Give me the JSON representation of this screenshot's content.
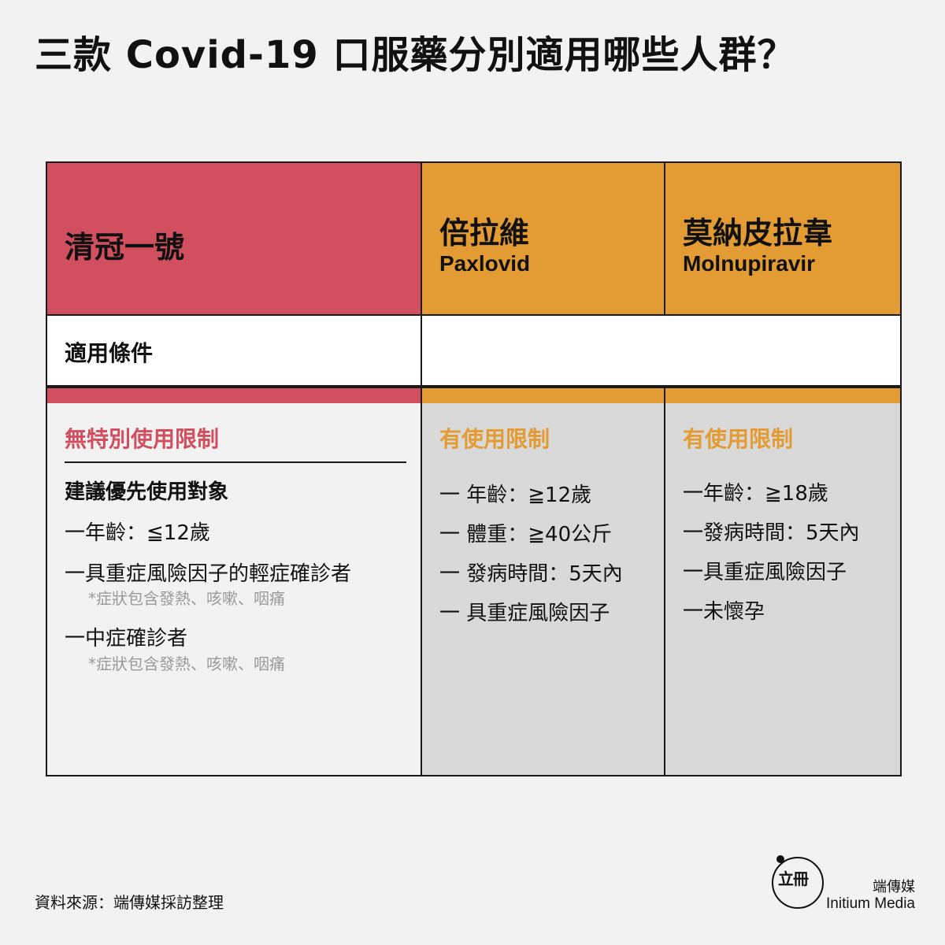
{
  "title": "三款 Covid-19 口服藥分別適用哪些人群？",
  "columns": [
    {
      "name": "清冠一號",
      "english": "",
      "restriction": "無特別使用限制",
      "subheading": "建議優先使用對象",
      "items": [
        {
          "text": "一年齡：≦12歲",
          "note": ""
        },
        {
          "text": "一具重症風險因子的輕症確診者",
          "note": "*症狀包含發熱、咳嗽、咽痛"
        },
        {
          "text": "一中症確診者",
          "note": "*症狀包含發熱、咳嗽、咽痛"
        }
      ]
    },
    {
      "name": "倍拉維",
      "english": "Paxlovid",
      "restriction": "有使用限制",
      "items": [
        {
          "text": "一 年齡：≧12歲"
        },
        {
          "text": "一 體重：≧40公斤"
        },
        {
          "text": "一 發病時間：5天內"
        },
        {
          "text": "一 具重症風險因子"
        }
      ]
    },
    {
      "name": "莫納皮拉韋",
      "english": "Molnupiravir",
      "restriction": "有使用限制",
      "items": [
        {
          "text": "一年齡：≧18歲"
        },
        {
          "text": "一發病時間：5天內"
        },
        {
          "text": "一具重症風險因子"
        },
        {
          "text": "一未懷孕"
        }
      ]
    }
  ],
  "condition_label": "適用條件",
  "source": "資料來源：端傳媒採訪整理",
  "brand": {
    "chinese": "端傳媒",
    "english": "Initium Media",
    "logo_text": "立冊"
  },
  "colors": {
    "red": "#d14f5f",
    "orange": "#e39b33",
    "background": "#f2f2f2",
    "grey_cell": "#d9d9d9"
  }
}
